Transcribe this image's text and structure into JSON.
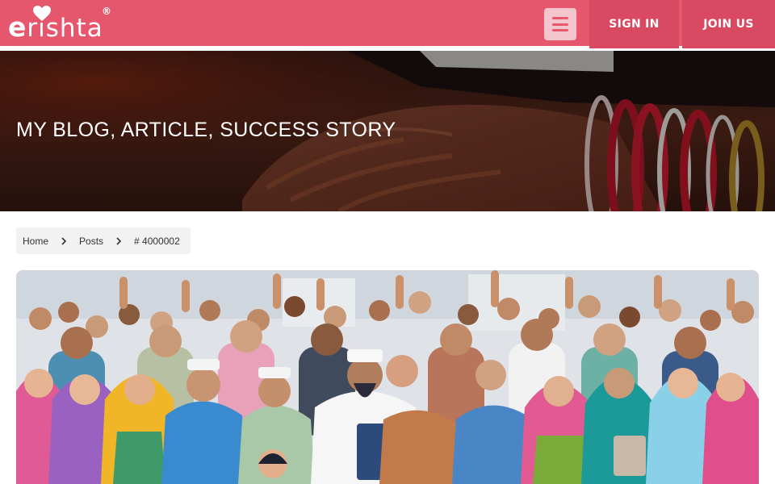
{
  "header": {
    "logo": {
      "text_e": "e",
      "text_rest": "rishta",
      "registered_mark": "®",
      "heart_icon": "heart-icon"
    },
    "menu_icon": "hamburger-icon",
    "sign_in_label": "SIGN IN",
    "join_us_label": "JOIN US",
    "colors": {
      "brand": "#e6576e",
      "button": "#d94a62",
      "menu_button": "#f4c5cd"
    }
  },
  "hero": {
    "title": "MY BLOG, ARTICLE, SUCCESS STORY"
  },
  "breadcrumb": {
    "items": [
      {
        "label": "Home"
      },
      {
        "label": "Posts"
      },
      {
        "label": "# 4000002"
      }
    ],
    "separator_icon": "chevron-right-icon"
  },
  "post": {
    "image_subject": "illustrated crowd of people"
  }
}
